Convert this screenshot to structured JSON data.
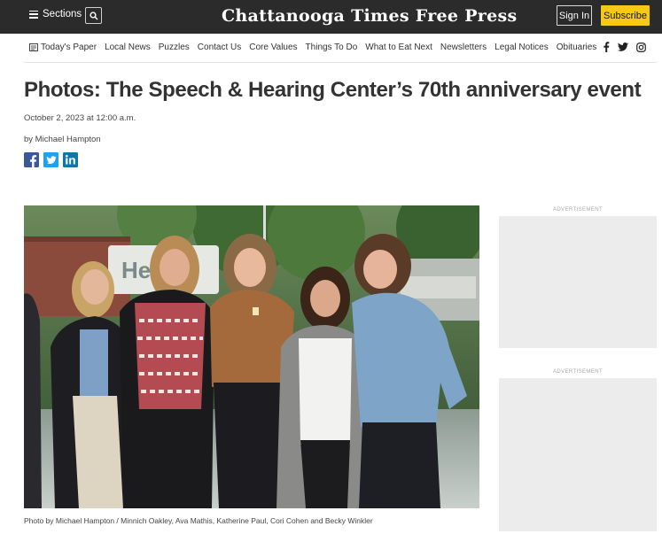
{
  "header": {
    "sections_label": "Sections",
    "logo_text": "Chattanooga Times Free Press",
    "signin_label": "Sign In",
    "subscribe_label": "Subscribe"
  },
  "nav": {
    "items": [
      "Today's Paper",
      "Local News",
      "Puzzles",
      "Contact Us",
      "Core Values",
      "Things To Do",
      "What to Eat Next",
      "Newsletters",
      "Legal Notices",
      "Obituaries"
    ]
  },
  "article": {
    "headline": "Photos: The Speech & Hearing Center’s 70th anniversary event",
    "date": "October 2, 2023 at 12:00 a.m.",
    "byline": "by Michael Hampton",
    "caption": "Photo by Michael Hampton / Minnich Oakley, Ava Mathis, Katherine Paul, Cori Cohen and Becky Winkler",
    "sign_text": "He"
  },
  "ads": {
    "label": "ADVERTISEMENT"
  },
  "colors": {
    "topbar": "#2b2b2b",
    "subscribe": "#f6c915",
    "facebook": "#3b5998",
    "twitter": "#1da1f2",
    "linkedin": "#0e76a8"
  }
}
